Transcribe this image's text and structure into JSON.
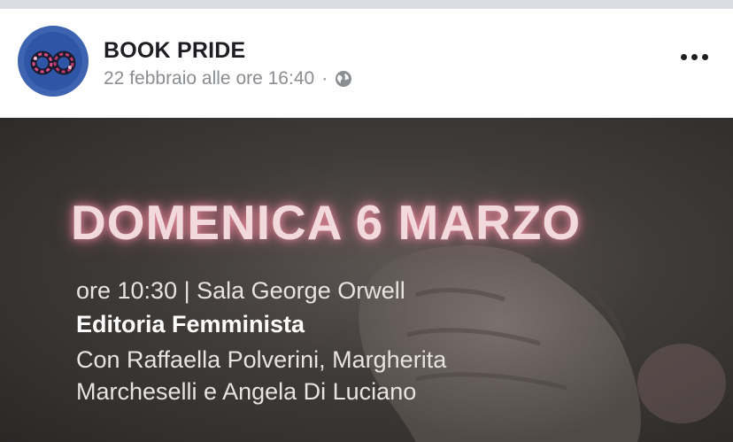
{
  "post": {
    "page_name": "BOOK PRIDE",
    "timestamp": "22 febbraio alle ore 16:40",
    "separator": "·",
    "audience_icon": "globe-icon",
    "more_icon": "more-horizontal-icon"
  },
  "image": {
    "headline": "DOMENICA 6 MARZO",
    "line1": "ore 10:30 | Sala George Orwell",
    "line2": "Editoria Femminista",
    "line3": "Con Raffaella Polverini, Margherita",
    "line4": "Marcheselli e Angela Di Luciano"
  },
  "colors": {
    "avatar_blue": "#3e64b1",
    "headline_glow": "#f2d9dc",
    "name_text": "#1c1e21",
    "meta_text": "#8a8d91"
  }
}
